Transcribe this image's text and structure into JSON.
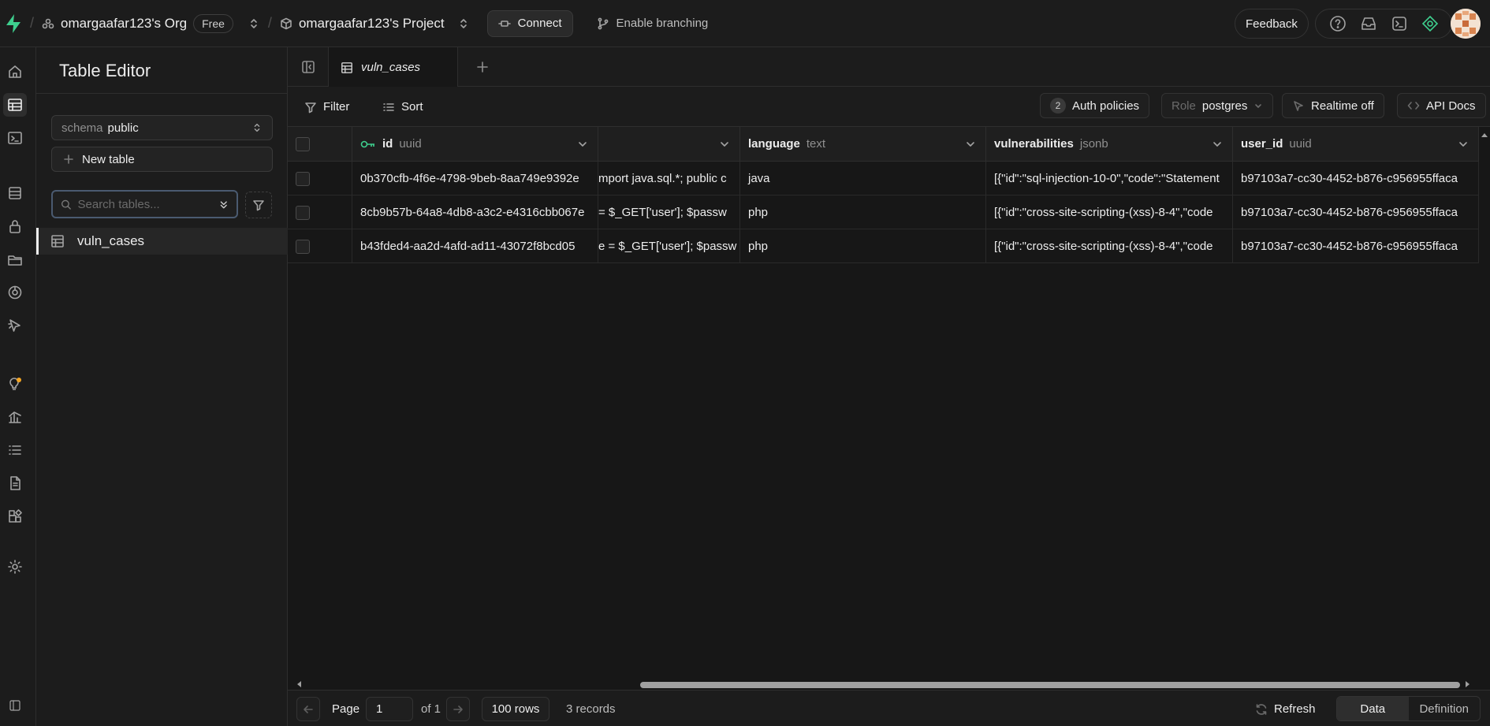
{
  "topbar": {
    "org": "omargaafar123's Org",
    "plan": "Free",
    "project": "omargaafar123's Project",
    "connect": "Connect",
    "branching": "Enable branching",
    "feedback": "Feedback"
  },
  "sidebar": {
    "title": "Table Editor",
    "schema_label": "schema",
    "schema_value": "public",
    "new_table": "New table",
    "search_placeholder": "Search tables...",
    "tables": [
      "vuln_cases"
    ]
  },
  "tabs": {
    "active": "vuln_cases"
  },
  "toolbar": {
    "filter": "Filter",
    "sort": "Sort",
    "auth_count": "2",
    "auth_policies": "Auth policies",
    "role_label": "Role",
    "role_value": "postgres",
    "realtime": "Realtime off",
    "api_docs": "API Docs"
  },
  "grid": {
    "columns": [
      {
        "name": "id",
        "type": "uuid"
      },
      {
        "name": "",
        "type": ""
      },
      {
        "name": "language",
        "type": "text"
      },
      {
        "name": "vulnerabilities",
        "type": "jsonb"
      },
      {
        "name": "user_id",
        "type": "uuid"
      }
    ],
    "rows": [
      {
        "id": "0b370cfb-4f6e-4798-9beb-8aa749e9392e",
        "code": "mport java.sql.*; public c",
        "language": "java",
        "vulnerabilities": "[{\"id\":\"sql-injection-10-0\",\"code\":\"Statement",
        "user_id": "b97103a7-cc30-4452-b876-c956955ffaca"
      },
      {
        "id": "8cb9b57b-64a8-4db8-a3c2-e4316cbb067e",
        "code": "= $_GET['user']; $passw",
        "language": "php",
        "vulnerabilities": "[{\"id\":\"cross-site-scripting-(xss)-8-4\",\"code",
        "user_id": "b97103a7-cc30-4452-b876-c956955ffaca"
      },
      {
        "id": "b43fded4-aa2d-4afd-ad11-43072f8bcd05",
        "code": "e = $_GET['user']; $passw",
        "language": "php",
        "vulnerabilities": "[{\"id\":\"cross-site-scripting-(xss)-8-4\",\"code",
        "user_id": "b97103a7-cc30-4452-b876-c956955ffaca"
      }
    ]
  },
  "footer": {
    "page_label": "Page",
    "page_value": "1",
    "of": "of 1",
    "rows": "100 rows",
    "records": "3 records",
    "refresh": "Refresh",
    "data": "Data",
    "definition": "Definition"
  },
  "colors": {
    "brand": "#3ecf8e",
    "background": "#1c1c1c",
    "grid_bg": "#171717"
  }
}
